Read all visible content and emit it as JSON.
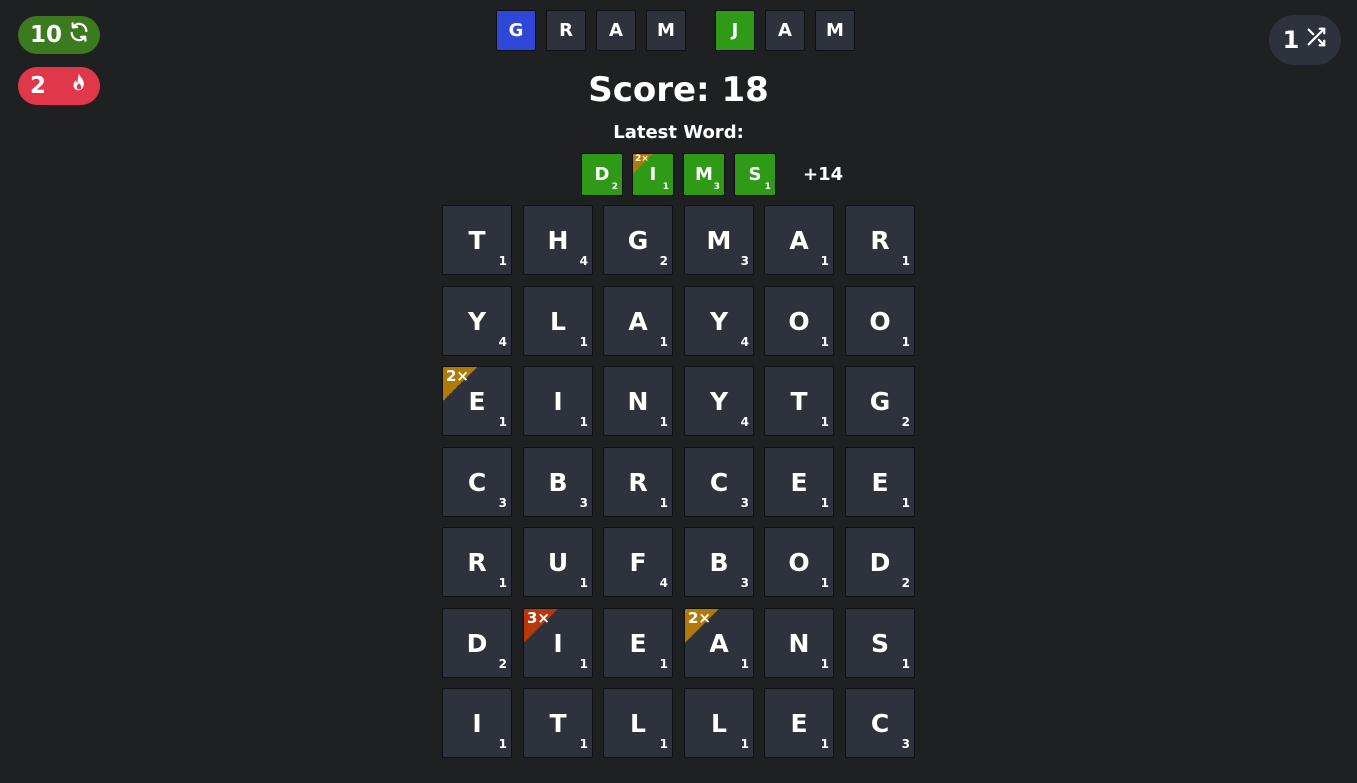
{
  "status": {
    "refresh_count": "10",
    "refresh_icon": "refresh-icon",
    "streak_count": "2",
    "streak_icon": "flame-icon",
    "refresh_color": "#3b7a1f",
    "streak_color": "#e0384a"
  },
  "shuffle": {
    "count": "1",
    "icon": "shuffle-icon"
  },
  "title_tiles": [
    {
      "letter": "G",
      "color": "blue"
    },
    {
      "letter": "R",
      "color": "default"
    },
    {
      "letter": "A",
      "color": "default"
    },
    {
      "letter": "M",
      "color": "default"
    },
    {
      "letter": "J",
      "color": "green"
    },
    {
      "letter": "A",
      "color": "default"
    },
    {
      "letter": "M",
      "color": "default"
    }
  ],
  "score_text": "Score: 18",
  "latest_label": "Latest Word:",
  "latest_word": [
    {
      "letter": "D",
      "value": "2",
      "mult": ""
    },
    {
      "letter": "I",
      "value": "1",
      "mult": "2×"
    },
    {
      "letter": "M",
      "value": "3",
      "mult": ""
    },
    {
      "letter": "S",
      "value": "1",
      "mult": ""
    }
  ],
  "latest_points": "+14",
  "grid": [
    [
      {
        "letter": "T",
        "value": "1"
      },
      {
        "letter": "H",
        "value": "4"
      },
      {
        "letter": "G",
        "value": "2"
      },
      {
        "letter": "M",
        "value": "3"
      },
      {
        "letter": "A",
        "value": "1"
      },
      {
        "letter": "R",
        "value": "1"
      }
    ],
    [
      {
        "letter": "Y",
        "value": "4"
      },
      {
        "letter": "L",
        "value": "1"
      },
      {
        "letter": "A",
        "value": "1"
      },
      {
        "letter": "Y",
        "value": "4"
      },
      {
        "letter": "O",
        "value": "1"
      },
      {
        "letter": "O",
        "value": "1"
      }
    ],
    [
      {
        "letter": "E",
        "value": "1",
        "mult": "2×"
      },
      {
        "letter": "I",
        "value": "1"
      },
      {
        "letter": "N",
        "value": "1"
      },
      {
        "letter": "Y",
        "value": "4"
      },
      {
        "letter": "T",
        "value": "1"
      },
      {
        "letter": "G",
        "value": "2"
      }
    ],
    [
      {
        "letter": "C",
        "value": "3"
      },
      {
        "letter": "B",
        "value": "3"
      },
      {
        "letter": "R",
        "value": "1"
      },
      {
        "letter": "C",
        "value": "3"
      },
      {
        "letter": "E",
        "value": "1"
      },
      {
        "letter": "E",
        "value": "1"
      }
    ],
    [
      {
        "letter": "R",
        "value": "1"
      },
      {
        "letter": "U",
        "value": "1"
      },
      {
        "letter": "F",
        "value": "4"
      },
      {
        "letter": "B",
        "value": "3"
      },
      {
        "letter": "O",
        "value": "1"
      },
      {
        "letter": "D",
        "value": "2"
      }
    ],
    [
      {
        "letter": "D",
        "value": "2"
      },
      {
        "letter": "I",
        "value": "1",
        "mult": "3×"
      },
      {
        "letter": "E",
        "value": "1"
      },
      {
        "letter": "A",
        "value": "1",
        "mult": "2×"
      },
      {
        "letter": "N",
        "value": "1"
      },
      {
        "letter": "S",
        "value": "1"
      }
    ],
    [
      {
        "letter": "I",
        "value": "1"
      },
      {
        "letter": "T",
        "value": "1"
      },
      {
        "letter": "L",
        "value": "1"
      },
      {
        "letter": "L",
        "value": "1"
      },
      {
        "letter": "E",
        "value": "1"
      },
      {
        "letter": "C",
        "value": "3"
      }
    ]
  ],
  "colors": {
    "background": "#1f2022",
    "tile": "#2d323c",
    "green": "#2f9a17",
    "blue": "#2f47d6",
    "mult2": "#b07a0a",
    "mult3": "#b8380b"
  }
}
